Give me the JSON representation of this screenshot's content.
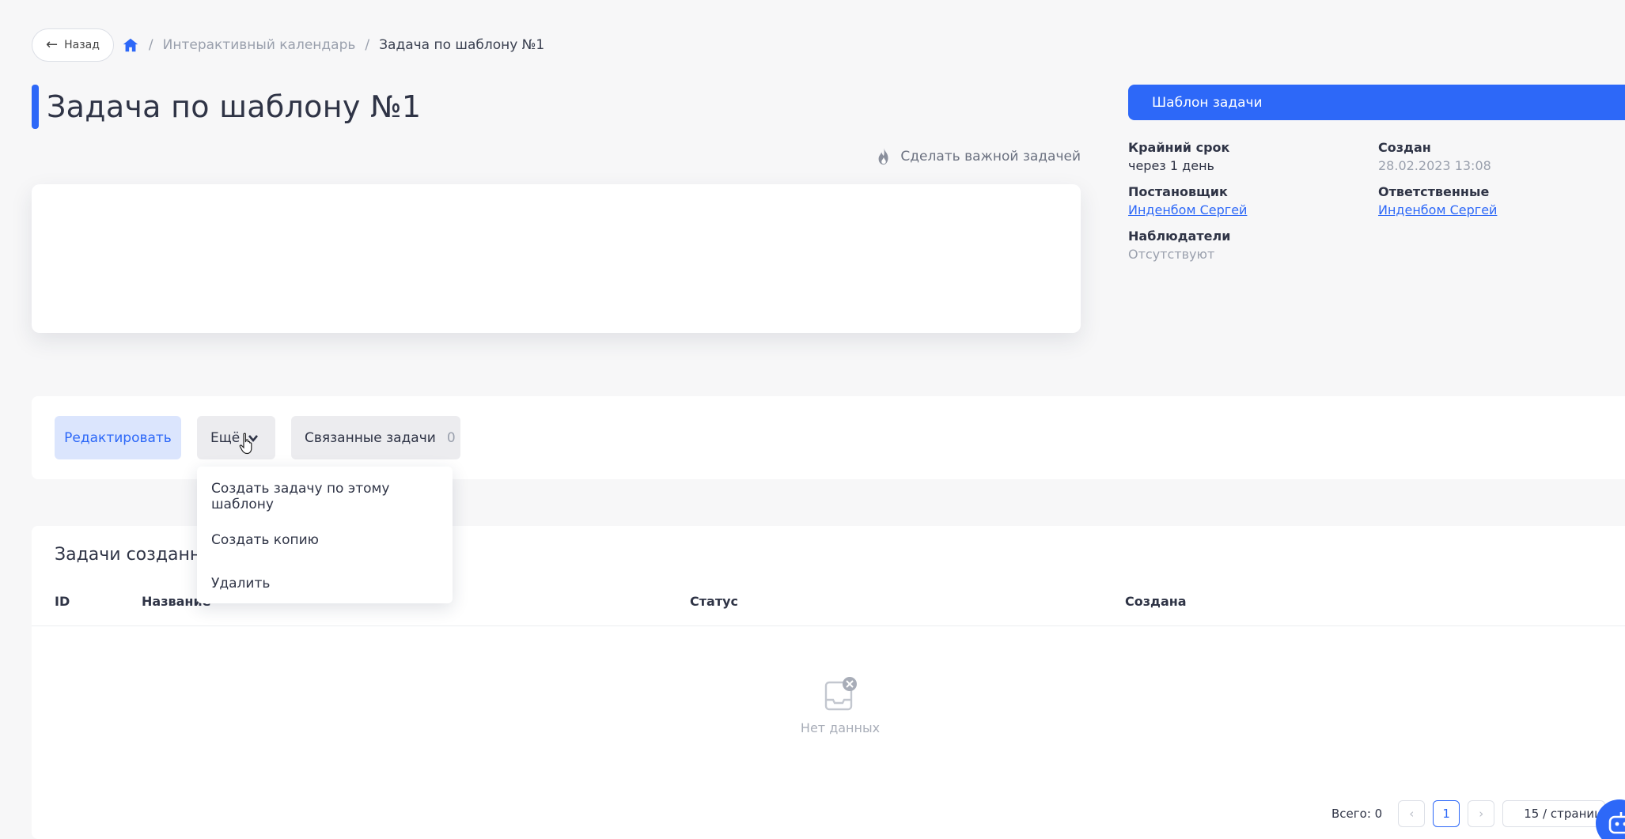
{
  "nav": {
    "back_label": "Назад",
    "breadcrumb": [
      "Интерактивный календарь",
      "Задача по шаблону №1"
    ],
    "separator": "/"
  },
  "task": {
    "title": "Задача по шаблону №1",
    "important_label": "Сделать важной задачей"
  },
  "sidebar": {
    "template_button": "Шаблон задачи",
    "deadline_label": "Крайний срок",
    "deadline_value": "через 1 день",
    "created_label": "Создан",
    "created_value": "28.02.2023 13:08",
    "assigner_label": "Постановщик",
    "assigner_value": "Инденбом Сергей",
    "responsible_label": "Ответственные",
    "responsible_value": "Инденбом Сергей",
    "observers_label": "Наблюдатели",
    "observers_value": "Отсутствуют"
  },
  "actions": {
    "edit_label": "Редактировать",
    "more_label": "Ещё",
    "related_label": "Связанные задачи",
    "related_count": "0"
  },
  "dropdown": {
    "items": [
      "Создать задачу по этому шаблону",
      "Создать копию",
      "Удалить"
    ]
  },
  "tasks_table": {
    "title": "Задачи созданны",
    "columns": [
      "ID",
      "Название",
      "Статус",
      "Создана"
    ],
    "empty_text": "Нет данных"
  },
  "pagination": {
    "total_label": "Всего: 0",
    "prev": "‹",
    "current_page": "1",
    "next": "›",
    "page_size": "15 / страниц"
  },
  "colors": {
    "accent": "#2d68f8",
    "accent_light": "#dbe5fd"
  }
}
